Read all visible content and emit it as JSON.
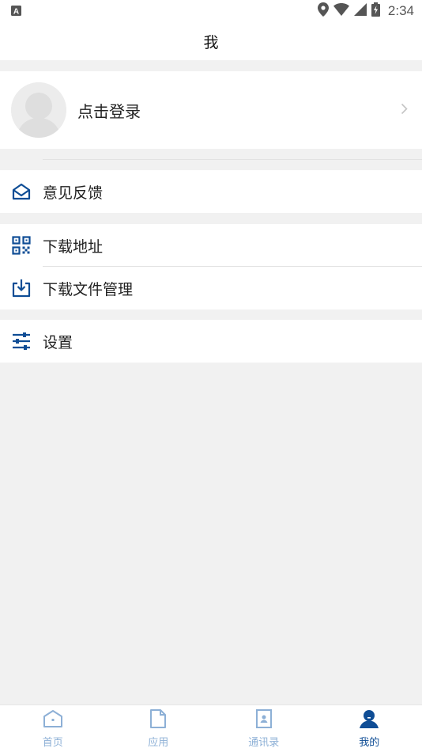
{
  "status_bar": {
    "time": "2:34",
    "left_icon": "a-notification-icon",
    "right_icons": [
      "location-icon",
      "wifi-icon",
      "signal-icon",
      "battery-icon"
    ]
  },
  "header": {
    "title": "我"
  },
  "profile": {
    "login_label": "点击登录"
  },
  "menu": {
    "feedback": "意见反馈",
    "download_address": "下载地址",
    "download_manager": "下载文件管理",
    "settings": "设置"
  },
  "tabbar": {
    "items": [
      {
        "label": "首页",
        "icon": "home-icon"
      },
      {
        "label": "应用",
        "icon": "document-icon"
      },
      {
        "label": "通讯录",
        "icon": "contacts-icon"
      },
      {
        "label": "我的",
        "icon": "user-icon"
      }
    ],
    "active_index": 3
  },
  "colors": {
    "accent": "#0f4d95",
    "inactive_tab": "#8db0d6",
    "background": "#f1f1f1"
  }
}
